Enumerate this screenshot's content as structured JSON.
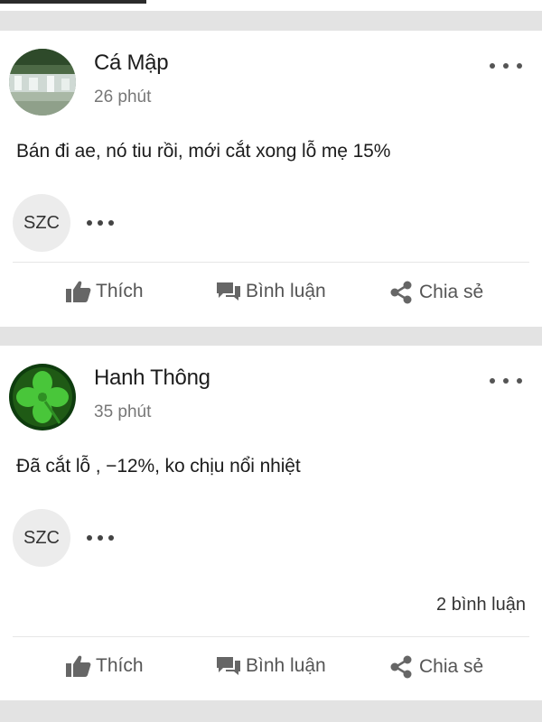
{
  "posts": [
    {
      "author": "Cá Mập",
      "time": "26 phút",
      "body": "Bán đi ae, nó tiu rồi, mới cắt xong lỗ mẹ 15%",
      "stock": "SZC",
      "avatar": "waterfall-photo",
      "actions": {
        "like": "Thích",
        "comment": "Bình luận",
        "share": "Chia sẻ"
      }
    },
    {
      "author": "Hanh Thông",
      "time": "35 phút",
      "body": "Đã cắt lỗ , −12%, ko chịu nổi nhiệt",
      "stock": "SZC",
      "avatar": "four-leaf-clover",
      "comment_count": "2 bình luận",
      "actions": {
        "like": "Thích",
        "comment": "Bình luận",
        "share": "Chia sẻ"
      }
    }
  ],
  "icons": {
    "like": "thumbs-up-icon",
    "comment": "comment-icon",
    "share": "share-icon",
    "more": "more-dots-icon"
  },
  "colors": {
    "background": "#e3e3e3",
    "card": "#ffffff",
    "text": "#1c1c1c",
    "muted": "#777777",
    "clover": "#3ec02c"
  }
}
